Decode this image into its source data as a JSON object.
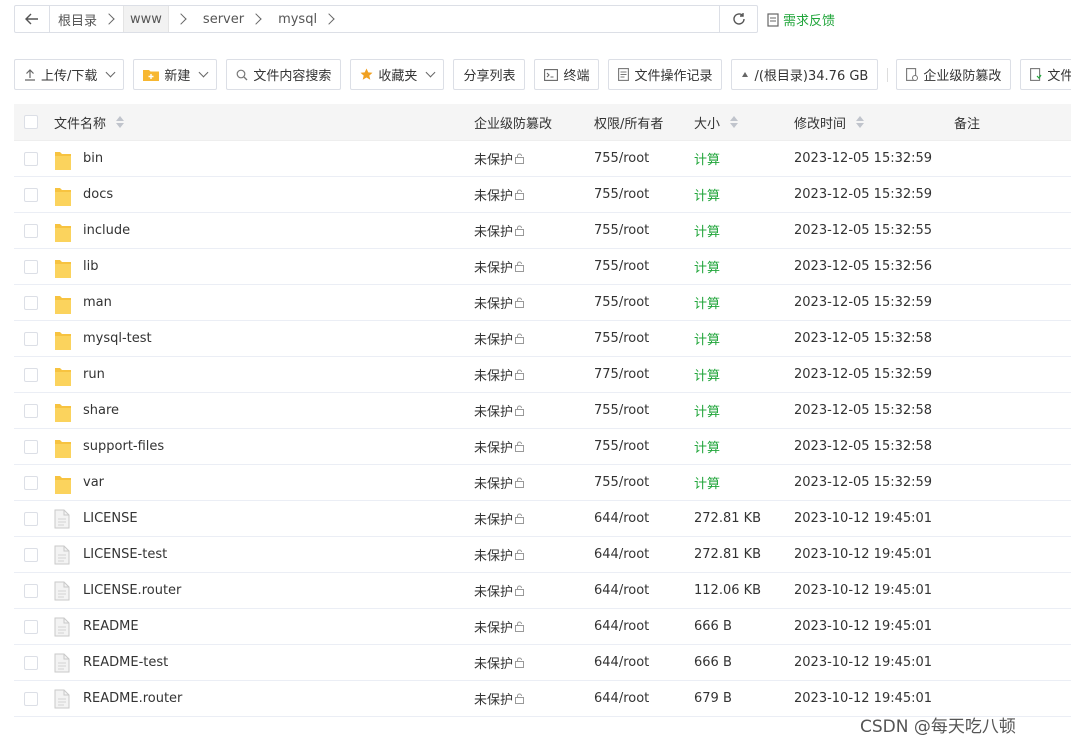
{
  "path": {
    "crumbs": [
      "根目录",
      "www",
      "server",
      "mysql"
    ],
    "active_index": 1,
    "feedback_label": "需求反馈"
  },
  "toolbar": {
    "upload": "上传/下载",
    "new": "新建",
    "search": "文件内容搜索",
    "favorites": "收藏夹",
    "share_list": "分享列表",
    "terminal": "终端",
    "op_log": "文件操作记录",
    "disk": "/(根目录)34.76 GB",
    "tamper": "企业级防篡改",
    "sync": "文件同步"
  },
  "table": {
    "headers": {
      "name": "文件名称",
      "protect": "企业级防篡改",
      "perm": "权限/所有者",
      "size": "大小",
      "mtime": "修改时间",
      "note": "备注"
    },
    "rows": [
      {
        "name": "bin",
        "type": "folder",
        "protect": "未保护",
        "perm": "755/root",
        "size": "计算",
        "mtime": "2023-12-05 15:32:59"
      },
      {
        "name": "docs",
        "type": "folder",
        "protect": "未保护",
        "perm": "755/root",
        "size": "计算",
        "mtime": "2023-12-05 15:32:59"
      },
      {
        "name": "include",
        "type": "folder",
        "protect": "未保护",
        "perm": "755/root",
        "size": "计算",
        "mtime": "2023-12-05 15:32:55"
      },
      {
        "name": "lib",
        "type": "folder",
        "protect": "未保护",
        "perm": "755/root",
        "size": "计算",
        "mtime": "2023-12-05 15:32:56"
      },
      {
        "name": "man",
        "type": "folder",
        "protect": "未保护",
        "perm": "755/root",
        "size": "计算",
        "mtime": "2023-12-05 15:32:59"
      },
      {
        "name": "mysql-test",
        "type": "folder",
        "protect": "未保护",
        "perm": "755/root",
        "size": "计算",
        "mtime": "2023-12-05 15:32:58"
      },
      {
        "name": "run",
        "type": "folder",
        "protect": "未保护",
        "perm": "775/root",
        "size": "计算",
        "mtime": "2023-12-05 15:32:59"
      },
      {
        "name": "share",
        "type": "folder",
        "protect": "未保护",
        "perm": "755/root",
        "size": "计算",
        "mtime": "2023-12-05 15:32:58"
      },
      {
        "name": "support-files",
        "type": "folder",
        "protect": "未保护",
        "perm": "755/root",
        "size": "计算",
        "mtime": "2023-12-05 15:32:58"
      },
      {
        "name": "var",
        "type": "folder",
        "protect": "未保护",
        "perm": "755/root",
        "size": "计算",
        "mtime": "2023-12-05 15:32:59"
      },
      {
        "name": "LICENSE",
        "type": "file",
        "protect": "未保护",
        "perm": "644/root",
        "size": "272.81 KB",
        "mtime": "2023-10-12 19:45:01"
      },
      {
        "name": "LICENSE-test",
        "type": "file",
        "protect": "未保护",
        "perm": "644/root",
        "size": "272.81 KB",
        "mtime": "2023-10-12 19:45:01"
      },
      {
        "name": "LICENSE.router",
        "type": "file",
        "protect": "未保护",
        "perm": "644/root",
        "size": "112.06 KB",
        "mtime": "2023-10-12 19:45:01"
      },
      {
        "name": "README",
        "type": "file",
        "protect": "未保护",
        "perm": "644/root",
        "size": "666 B",
        "mtime": "2023-10-12 19:45:01"
      },
      {
        "name": "README-test",
        "type": "file",
        "protect": "未保护",
        "perm": "644/root",
        "size": "666 B",
        "mtime": "2023-10-12 19:45:01"
      },
      {
        "name": "README.router",
        "type": "file",
        "protect": "未保护",
        "perm": "644/root",
        "size": "679 B",
        "mtime": "2023-10-12 19:45:01"
      }
    ]
  },
  "watermark": "CSDN @每天吃八顿",
  "colors": {
    "accent": "#20a53a",
    "folder": "#f7c340",
    "border": "#dcdfe6",
    "header_bg": "#f5f5f5"
  }
}
